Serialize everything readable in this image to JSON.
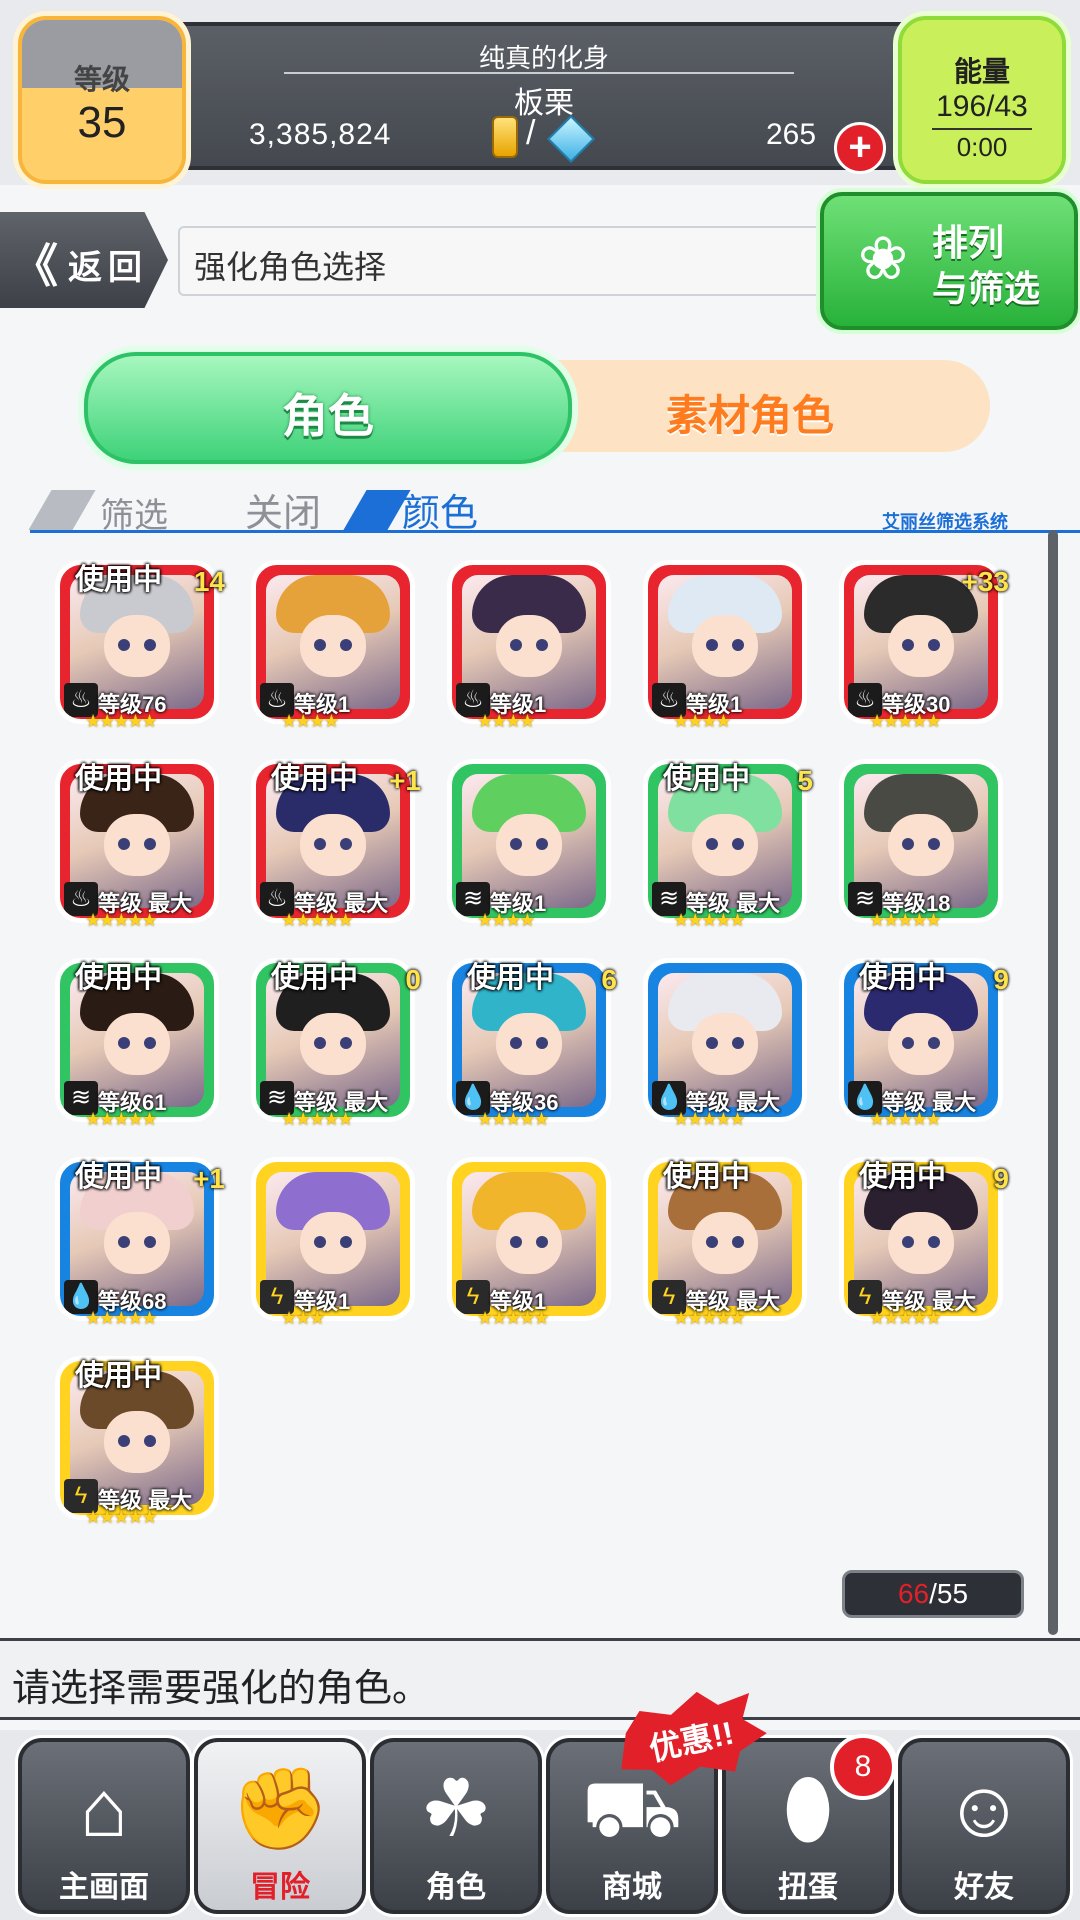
{
  "header": {
    "title": "纯真的化身",
    "name": "板栗",
    "money": "3,385,824",
    "slash": "/",
    "gems": "265",
    "plus_icon": "+",
    "level_label": "等级",
    "level_value": "35",
    "energy_label": "能量",
    "energy_value": "196/43",
    "energy_timer": "0:00"
  },
  "subheader": {
    "back_arrows": "《",
    "back_label": "返回",
    "title": "强化角色选择",
    "sort_line1": "排列",
    "sort_line2": "与筛选"
  },
  "tabs": {
    "character": "角色",
    "material": "素材角色"
  },
  "filter": {
    "filter_label": "筛选",
    "filter_state": "关闭",
    "color_label": "颜色",
    "system_label": "艾丽丝筛选系统"
  },
  "cards": [
    {
      "color": "red",
      "in_use": "使用中",
      "plus": "14",
      "element": "fire-icon",
      "level": "等级76",
      "stars": "★★★★★"
    },
    {
      "color": "red",
      "in_use": "",
      "plus": "",
      "element": "fire-icon",
      "level": "等级1",
      "stars": "★★★★"
    },
    {
      "color": "red",
      "in_use": "",
      "plus": "",
      "element": "fire-icon",
      "level": "等级1",
      "stars": "★★★★"
    },
    {
      "color": "red",
      "in_use": "",
      "plus": "",
      "element": "fire-icon",
      "level": "等级1",
      "stars": "★★★★"
    },
    {
      "color": "red",
      "in_use": "",
      "plus": "+33",
      "element": "fire-icon",
      "level": "等级30",
      "stars": "★★★★★"
    },
    {
      "color": "red",
      "in_use": "使用中",
      "plus": "",
      "element": "fire-icon",
      "level": "等级 最大",
      "stars": "★★★★★"
    },
    {
      "color": "red",
      "in_use": "使用中",
      "plus": "+1",
      "element": "fire-icon",
      "level": "等级 最大",
      "stars": "★★★★★"
    },
    {
      "color": "green",
      "in_use": "",
      "plus": "",
      "element": "wind-icon",
      "level": "等级1",
      "stars": "★★★★"
    },
    {
      "color": "green",
      "in_use": "使用中",
      "plus": "5",
      "element": "wind-icon",
      "level": "等级 最大",
      "stars": "★★★★★"
    },
    {
      "color": "green",
      "in_use": "",
      "plus": "",
      "element": "wind-icon",
      "level": "等级18",
      "stars": "★★★★★"
    },
    {
      "color": "green",
      "in_use": "使用中",
      "plus": "",
      "element": "wind-icon",
      "level": "等级61",
      "stars": "★★★★★"
    },
    {
      "color": "green",
      "in_use": "使用中",
      "plus": "0",
      "element": "wind-icon",
      "level": "等级 最大",
      "stars": "★★★★★"
    },
    {
      "color": "blue",
      "in_use": "使用中",
      "plus": "6",
      "element": "water-icon",
      "level": "等级36",
      "stars": "★★★★★"
    },
    {
      "color": "blue",
      "in_use": "",
      "plus": "",
      "element": "water-icon",
      "level": "等级 最大",
      "stars": "★★★★★"
    },
    {
      "color": "blue",
      "in_use": "使用中",
      "plus": "9",
      "element": "water-icon",
      "level": "等级 最大",
      "stars": "★★★★★"
    },
    {
      "color": "blue",
      "in_use": "使用中",
      "plus": "+1",
      "element": "water-icon",
      "level": "等级68",
      "stars": "★★★★★"
    },
    {
      "color": "yellow",
      "in_use": "",
      "plus": "",
      "element": "lightning-icon",
      "level": "等级1",
      "stars": "★★★"
    },
    {
      "color": "yellow",
      "in_use": "",
      "plus": "",
      "element": "lightning-icon",
      "level": "等级1",
      "stars": "★★★★★"
    },
    {
      "color": "yellow",
      "in_use": "使用中",
      "plus": "",
      "element": "lightning-icon",
      "level": "等级 最大",
      "stars": "★★★★★"
    },
    {
      "color": "yellow",
      "in_use": "使用中",
      "plus": "9",
      "element": "lightning-icon",
      "level": "等级 最大",
      "stars": "★★★★★"
    },
    {
      "color": "yellow",
      "in_use": "使用中",
      "plus": "",
      "element": "lightning-icon",
      "level": "等级 最大",
      "stars": "★★★★★"
    }
  ],
  "count": {
    "current": "66",
    "max": "/55"
  },
  "message": "请选择需要强化的角色。",
  "nav": {
    "home": "主画面",
    "adventure": "冒险",
    "character": "角色",
    "shop": "商城",
    "gacha": "扭蛋",
    "friends": "好友",
    "gacha_badge": "8",
    "promo": "优惠!!"
  },
  "colors": {
    "red": "#e8242e",
    "green": "#31c463",
    "blue": "#1884e2",
    "yellow": "#ffd31f",
    "accent_blue": "#1b6fd6"
  }
}
